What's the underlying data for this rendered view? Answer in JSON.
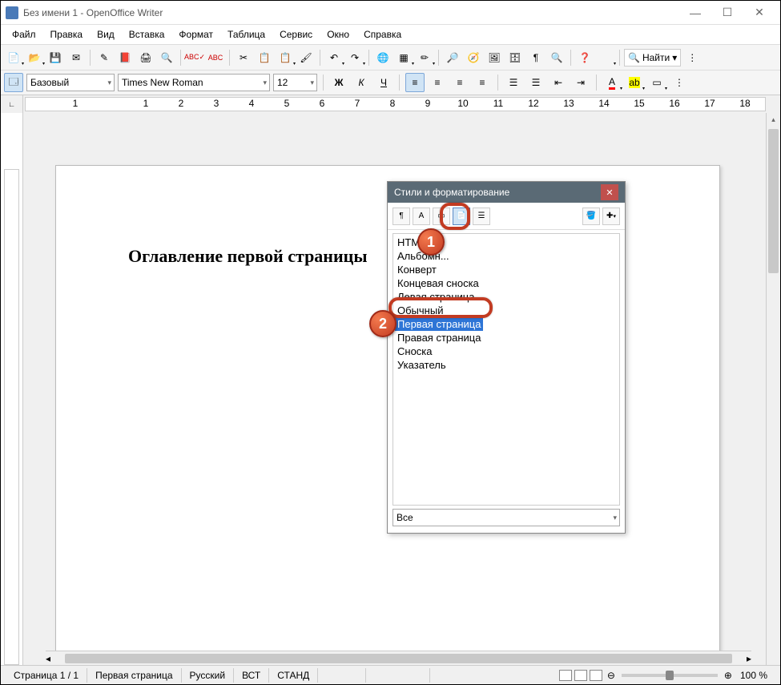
{
  "window": {
    "title": "Без имени 1 - OpenOffice Writer"
  },
  "menu": [
    "Файл",
    "Правка",
    "Вид",
    "Вставка",
    "Формат",
    "Таблица",
    "Сервис",
    "Окно",
    "Справка"
  ],
  "format_bar": {
    "style": "Базовый",
    "font": "Times New Roman",
    "size": "12"
  },
  "ruler_ticks": [
    "1",
    "",
    "1",
    "2",
    "3",
    "4",
    "5",
    "6",
    "7",
    "8",
    "9",
    "10",
    "11",
    "12",
    "13",
    "14",
    "15",
    "16",
    "17",
    "18"
  ],
  "document": {
    "heading": "Оглавление первой страницы"
  },
  "find_label": "Найти",
  "styles_panel": {
    "title": "Стили и форматирование",
    "items": [
      "HTML",
      "Альбомн...",
      "Конверт",
      "Концевая сноска",
      "Левая страница",
      "Обычный",
      "Первая страница",
      "Правая страница",
      "Сноска",
      "Указатель"
    ],
    "selected_index": 6,
    "filter": "Все"
  },
  "callouts": {
    "b1": "1",
    "b2": "2"
  },
  "status": {
    "page": "Страница 1 / 1",
    "style": "Первая страница",
    "lang": "Русский",
    "ins": "ВСТ",
    "mode": "СТАНД",
    "zoom": "100 %"
  }
}
